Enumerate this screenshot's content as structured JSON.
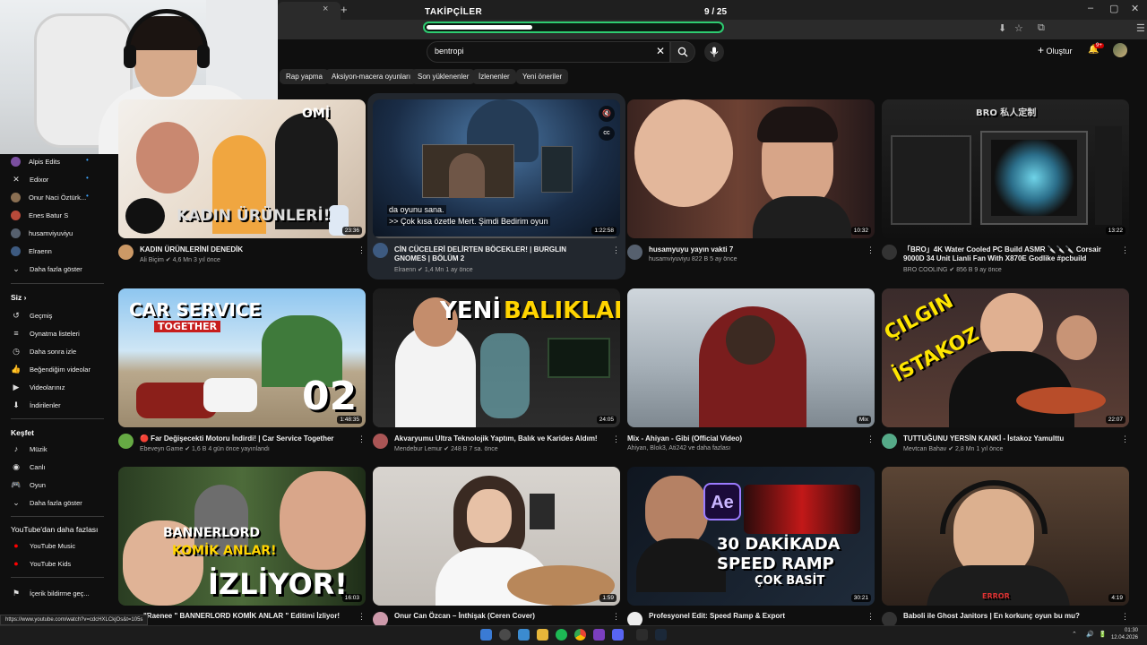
{
  "browser": {
    "new_tab_label": "+",
    "tab_close": "×",
    "window_controls": [
      "–",
      "▢",
      "✕"
    ],
    "toolbar_icons": [
      "⬇",
      "☆",
      "⧉",
      "☰"
    ]
  },
  "goal": {
    "title": "TAKİPÇİLER",
    "count": "9 / 25",
    "progress": 0.36
  },
  "header": {
    "search_value": "bentropi",
    "clear": "✕",
    "create_label": "Oluştur",
    "create_icon": "+",
    "notification_badge": "9+"
  },
  "chips": [
    "Rap yapma",
    "Aksiyon-macera oyunları",
    "Son yüklenenler",
    "İzlenenler",
    "Yeni öneriler"
  ],
  "sidebar": {
    "subscriptions": [
      {
        "label": "Alpis Edits",
        "live": true,
        "icon": "avatar",
        "color": "#7b4fa0"
      },
      {
        "label": "Edixor",
        "live": true,
        "icon": "✕",
        "color": "#222"
      },
      {
        "label": "Onur Naci Öztürk...",
        "live": true,
        "icon": "avatar",
        "color": "#8a6f52"
      },
      {
        "label": "Enes Batur S",
        "live": false,
        "icon": "avatar",
        "color": "#b84a3a"
      },
      {
        "label": "husamviyuviyu",
        "live": false,
        "icon": "avatar",
        "color": "#56606e"
      },
      {
        "label": "Elraenn",
        "live": false,
        "icon": "avatar",
        "color": "#3d5a80"
      }
    ],
    "show_more_1": "Daha fazla göster",
    "you_heading": "Siz",
    "you_chevron": "›",
    "you_items": [
      {
        "label": "Geçmiş",
        "icon": "↺"
      },
      {
        "label": "Oynatma listeleri",
        "icon": "≡"
      },
      {
        "label": "Daha sonra izle",
        "icon": "◷"
      },
      {
        "label": "Beğendiğim videolar",
        "icon": "👍"
      },
      {
        "label": "Videolarınız",
        "icon": "▶"
      },
      {
        "label": "İndirilenler",
        "icon": "⬇"
      }
    ],
    "explore_heading": "Keşfet",
    "explore_items": [
      {
        "label": "Müzik",
        "icon": "♪"
      },
      {
        "label": "Canlı",
        "icon": "◉"
      },
      {
        "label": "Oyun",
        "icon": "🎮"
      },
      {
        "label": "Daha fazla göster",
        "icon": "⌄"
      }
    ],
    "more_yt_heading": "YouTube'dan daha fazlası",
    "more_yt_items": [
      {
        "label": "YouTube Music",
        "icon": "●"
      },
      {
        "label": "YouTube Kids",
        "icon": "●"
      }
    ],
    "report_label": "İçerik bildirme geç...",
    "report_icon": "⚑"
  },
  "videos": [
    {
      "title": "KADIN ÜRÜNLERİNİ DENEDİK",
      "channel": "Ali Biçim",
      "verified": true,
      "meta": "4,6 Mn  3 yıl önce",
      "duration": "23:36",
      "thumb_text": "KADIN ÜRÜNLERİ!",
      "thumb_text_2": "OMİ",
      "avatar_color": "#c96"
    },
    {
      "title": "CİN CÜCELERİ DELİRTEN BÖCEKLER! | BURGLIN GNOMES | BÖLÜM 2",
      "channel": "Elraenn",
      "verified": true,
      "meta": "1,4 Mn  1 ay önce",
      "duration": "1:22:58",
      "caption_1": "da oyunu sana.",
      "caption_2": ">> Çok kısa özetle Mert. Şimdi Bedirim oyun",
      "mute_icon": "🔇",
      "cc_icon": "CC",
      "avatar_color": "#3d5a80"
    },
    {
      "title": "husamyuyu yayın vakti 7",
      "channel": "husamviyuviyu",
      "verified": false,
      "meta": "822 B  5 ay önce",
      "duration": "10:32",
      "avatar_color": "#56606e"
    },
    {
      "title": "「BRO」4K Water Cooled PC Build ASMR 🔪🔪🔪 Corsair 9000D 34 Unit Lianli Fan With X870E Godlike #pcbuild",
      "channel": "BRO COOLING",
      "verified": true,
      "meta": "856 B  9 ay önce",
      "duration": "13:22",
      "thumb_text": "BRO 私人定制",
      "avatar_color": "#333"
    },
    {
      "title": "🔴 Far Değişecekti Motoru İndirdi! | Car Service Together",
      "channel": "Ebeveyn Game",
      "verified": true,
      "meta": "1,6 B  4 gün önce yayınlandı",
      "duration": "1:48:35",
      "thumb_text": "CAR SERVICE",
      "thumb_text_2": "TOGETHER",
      "thumb_text_3": "02",
      "avatar_color": "#6a4"
    },
    {
      "title": "Akvaryumu Ultra Teknolojik Yaptım, Balık ve Karides Aldım!",
      "channel": "Mendebur Lemur",
      "verified": true,
      "meta": "248 B  7 sa. önce",
      "duration": "24:05",
      "thumb_text": "YENİ",
      "thumb_text_2": "BALIKLAR",
      "avatar_color": "#a55"
    },
    {
      "title": "Mix - Ahiyan - Gibi (Official Video)",
      "channel": "Ahiyan, Blok3, Ati242 ve daha fazlası",
      "verified": false,
      "meta": "",
      "duration": "Mix",
      "avatar_color": ""
    },
    {
      "title": "TUTTUĞUNU YERSİN KANKİ - İstakoz Yamulttu",
      "channel": "Mevtcan Bahav",
      "verified": true,
      "meta": "2,8 Mn  1 yıl önce",
      "duration": "22:07",
      "thumb_text": "ÇILGIN",
      "thumb_text_2": "İSTAKOZ",
      "avatar_color": "#5a8"
    },
    {
      "title": "\"Raenee \" BANNERLORD KOMİK ANLAR \" Editimi İzliyor!",
      "channel": "",
      "verified": false,
      "meta": "",
      "duration": "16:03",
      "thumb_text": "BANNERLORD",
      "thumb_text_2": "KOMİK ANLAR!",
      "thumb_text_3": "İZLİYOR!",
      "avatar_color": ""
    },
    {
      "title": "Onur Can Özcan – İnthişak (Ceren Cover)",
      "channel": "",
      "verified": false,
      "meta": "",
      "duration": "1:59",
      "avatar_color": "#c9a"
    },
    {
      "title": "Profesyonel Edit: Speed Ramp & Export",
      "channel": "",
      "verified": false,
      "meta": "",
      "duration": "30:21",
      "thumb_text": "30 DAKİKADA",
      "thumb_text_2": "SPEED RAMP",
      "thumb_text_3": "ÇOK BASİT",
      "thumb_text_4": "Ae",
      "avatar_color": "#eee"
    },
    {
      "title": "Baboli ile Ghost Janitors | En korkunç oyun bu mu?",
      "channel": "",
      "verified": false,
      "meta": "",
      "duration": "4:19",
      "thumb_text_2": "ERROR",
      "avatar_color": "#333"
    }
  ],
  "more_icon": "⋮",
  "status_url": "https://www.youtube.com/watch?v=cdcHXLCkjOs&t=105s",
  "taskbar": {
    "tray_icons": [
      "⌃",
      "🔊",
      "🔋"
    ],
    "time": "01:30",
    "date": "12.04.2026"
  },
  "colors": {
    "goal_border": "#2ecc71",
    "live_dot": "#3ea6ff",
    "youtube_red": "#ff0000"
  }
}
